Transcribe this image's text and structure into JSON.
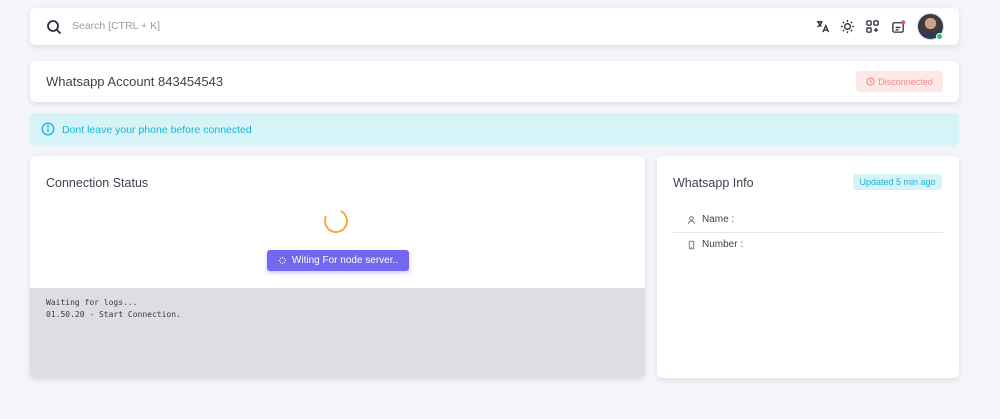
{
  "navbar": {
    "search_placeholder": "Search [CTRL + K]",
    "icons": [
      "search-icon",
      "translate-icon",
      "sun-icon",
      "apps-icon",
      "notification-icon"
    ]
  },
  "account": {
    "title": "Whatsapp Account 843454543",
    "status_badge": "Disconnected"
  },
  "alert": {
    "text": "Dont leave your phone before connected"
  },
  "connection": {
    "title": "Connection Status",
    "button_label": "Witing For node server..",
    "logs": [
      "Waiting for logs...",
      "01.50.20 - Start Connection."
    ]
  },
  "info": {
    "title": "Whatsapp Info",
    "updated_badge": "Updated 5 min ago",
    "name_label": "Name :",
    "number_label": "Number :"
  },
  "colors": {
    "primary": "#7367f0",
    "info": "#19b7d4",
    "danger_soft": "#fde8e8",
    "warning": "#f7a93b",
    "online": "#28c76f"
  }
}
